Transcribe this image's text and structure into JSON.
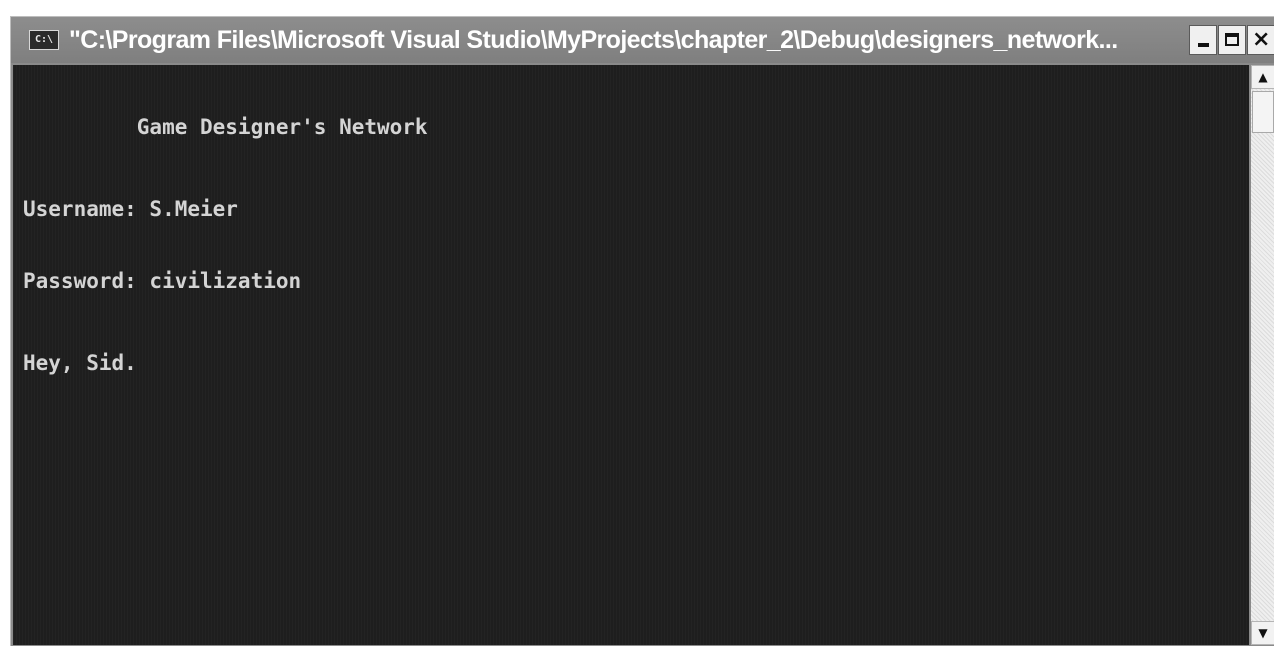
{
  "window": {
    "title": "\"C:\\Program Files\\Microsoft Visual Studio\\MyProjects\\chapter_2\\Debug\\designers_network...",
    "icon_text": "C:\\",
    "buttons": {
      "minimize_icon": "minimize-icon",
      "maximize_icon": "maximize-icon",
      "close_icon": "close-icon",
      "close_glyph": "×"
    }
  },
  "console": {
    "heading": "         Game Designer's Network",
    "username_line": "Username: S.Meier",
    "password_line": "Password: civilization",
    "greeting": "Hey, Sid."
  },
  "scrollbar": {
    "up_glyph": "▲",
    "down_glyph": "▼"
  },
  "colors": {
    "console_background": "#1e1e1e",
    "console_text": "#d4d4d4",
    "titlebar": "#8a8a8a"
  }
}
